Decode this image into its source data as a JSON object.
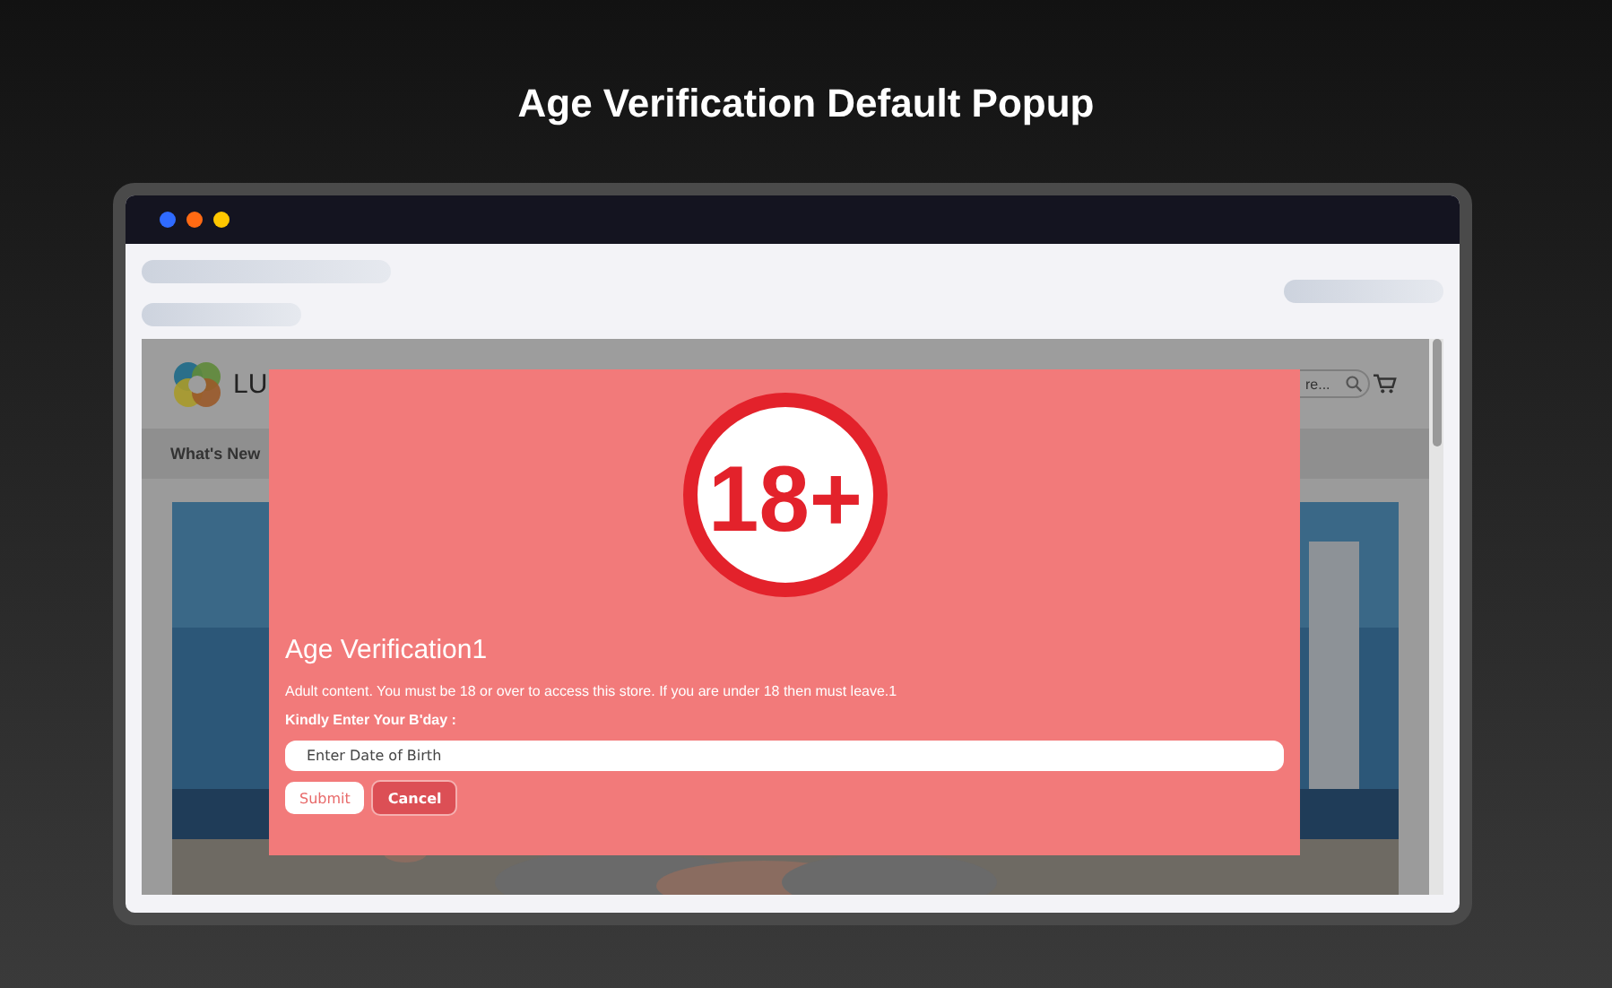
{
  "page_title": "Age Verification Default Popup",
  "browser": {
    "window_dots": [
      {
        "color": "#2f6bff"
      },
      {
        "color": "#ff6a13"
      },
      {
        "color": "#ffc700"
      }
    ]
  },
  "site": {
    "logo_text": "LU",
    "search": {
      "placeholder": "re..."
    },
    "nav": [
      {
        "label": "What's New"
      }
    ]
  },
  "popup": {
    "badge": "18+",
    "title": "Age Verification1",
    "message": "Adult content. You must be 18 or over to access this store. If you are under 18 then must leave.1",
    "label": "Kindly Enter Your B'day :",
    "field": {
      "placeholder": "Enter Date of Birth"
    },
    "buttons": [
      {
        "label": "Submit",
        "kind": "secondary"
      },
      {
        "label": "Cancel",
        "kind": "primary"
      }
    ]
  }
}
